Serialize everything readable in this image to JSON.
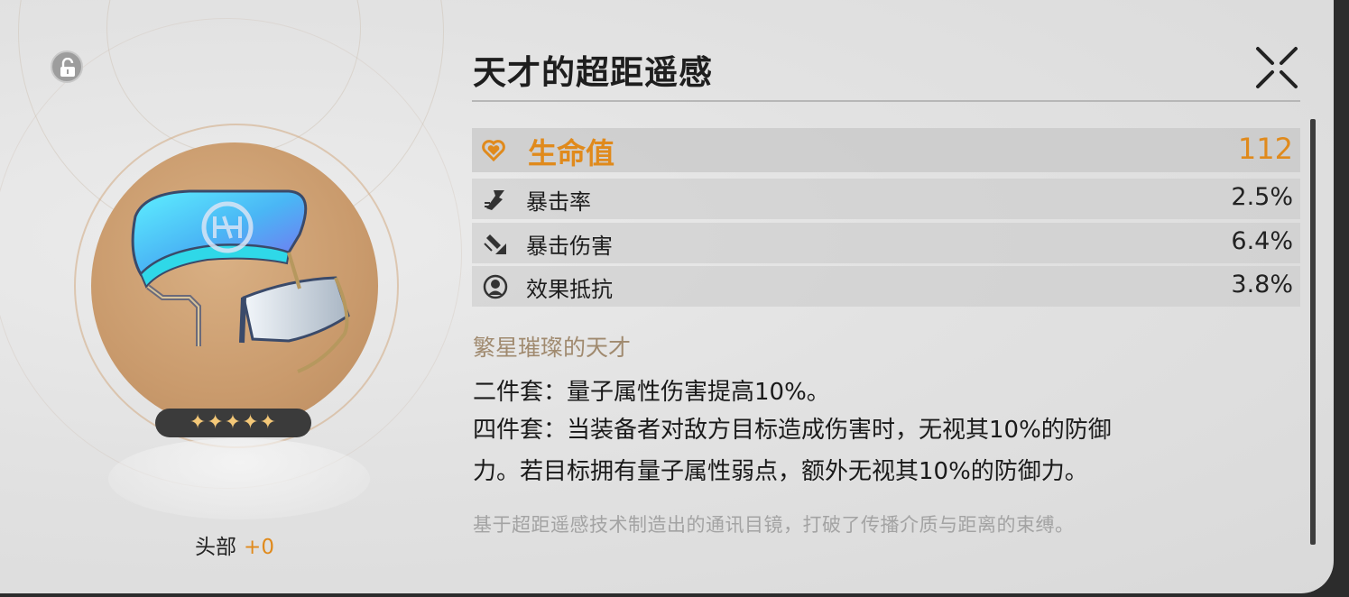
{
  "relic": {
    "title": "天才的超距遥感",
    "slot": "头部",
    "level": "+0",
    "stars": "✦✦✦✦✦",
    "rarity": 5
  },
  "stats": {
    "main": {
      "name": "生命值",
      "value": "112",
      "icon": "heart-icon"
    },
    "subs": [
      {
        "name": "暴击率",
        "value": "2.5%",
        "icon": "crit-rate-icon"
      },
      {
        "name": "暴击伤害",
        "value": "6.4%",
        "icon": "crit-dmg-icon"
      },
      {
        "name": "效果抵抗",
        "value": "3.8%",
        "icon": "effect-res-icon"
      }
    ]
  },
  "set": {
    "name": "繁星璀璨的天才",
    "two_piece": "二件套：量子属性伤害提高10%。",
    "four_piece_line1": "四件套：当装备者对敌方目标造成伤害时，无视其10%的防御",
    "four_piece_line2": "力。若目标拥有量子属性弱点，额外无视其10%的防御力。"
  },
  "flavor": "基于超距遥感技术制造出的通讯目镜，打破了传播介质与距离的束缚。",
  "colors": {
    "accent": "#e08a1c",
    "set_name": "#a08a6f",
    "flavor": "#a3a3a3",
    "relic_bg": "#c99a6c"
  }
}
